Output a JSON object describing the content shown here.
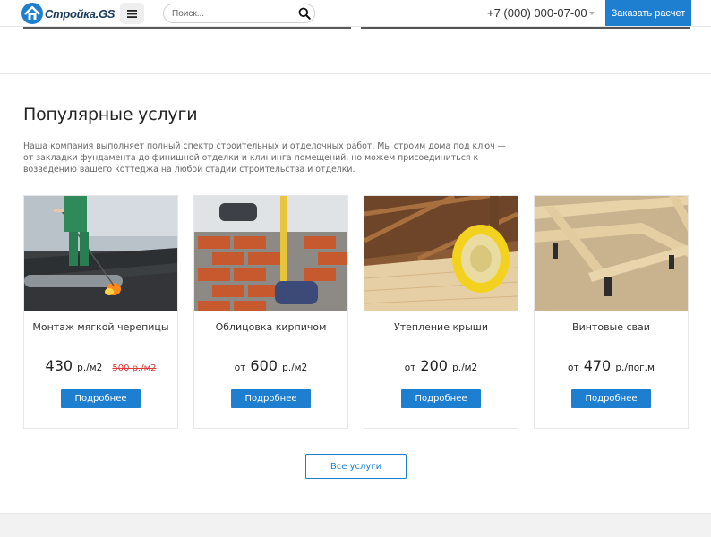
{
  "header": {
    "logo_text": "Стройка.GS",
    "search_placeholder": "Поиск...",
    "phone": "+7 (000) 000-07-00",
    "order_button": "Заказать расчет"
  },
  "services": {
    "title": "Популярные услуги",
    "description": "Наша компания выполняет полный спектр строительных и отделочных работ. Мы строим дома под ключ — от закладки фундамента до финишной отделки и клининга помещений, но можем присоединиться к возведению вашего коттеджа на любой стадии строительства и отделки.",
    "cards": [
      {
        "title": "Монтаж мягкой черепицы",
        "price_prefix": "",
        "price": "430",
        "unit": "р./м2",
        "old_price": "500 р./м2",
        "button": "Подробнее"
      },
      {
        "title": "Облицовка кирпичом",
        "price_prefix": "от",
        "price": "600",
        "unit": "р./м2",
        "old_price": "",
        "button": "Подробнее"
      },
      {
        "title": "Утепление крыши",
        "price_prefix": "от",
        "price": "200",
        "unit": "р./м2",
        "old_price": "",
        "button": "Подробнее"
      },
      {
        "title": "Винтовые сваи",
        "price_prefix": "от",
        "price": "470",
        "unit": "р./пог.м",
        "old_price": "",
        "button": "Подробнее"
      }
    ],
    "all_button": "Все услуги"
  },
  "colors": {
    "accent": "#1e7fd0",
    "old_price": "#e03a3a"
  },
  "icons": {
    "menu": "hamburger-icon",
    "search": "search-icon",
    "logo": "house-logo-icon"
  }
}
